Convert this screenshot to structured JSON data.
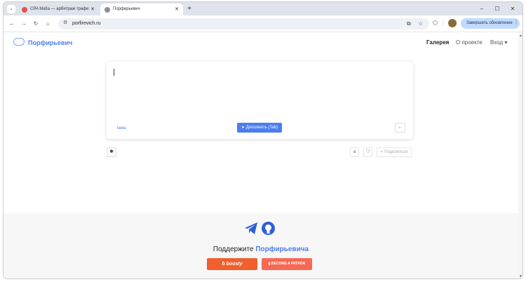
{
  "browser": {
    "tabs": [
      {
        "title": "CPA Mafia — арбитраж трафи",
        "active": false
      },
      {
        "title": "Порфирьевич",
        "active": true
      }
    ],
    "url": "porfirevich.ru",
    "update_button": "Завершить обновление"
  },
  "site": {
    "logo_text": "Порфирьевич",
    "nav": {
      "gallery": "Галерея",
      "about": "О проекте",
      "login": "Вход"
    }
  },
  "editor": {
    "model_label": "lawa",
    "complete_button": "Дополнить (Tab)",
    "share_button": "Поделиться"
  },
  "footer": {
    "support_prefix": "Поддержите ",
    "support_name": "Порфирьевича",
    "boosty_label": "boosty",
    "patreon_label": "BECOME A PATRON"
  },
  "colors": {
    "accent": "#4c7df0",
    "boosty": "#f15f2c",
    "patreon": "#f96854"
  }
}
